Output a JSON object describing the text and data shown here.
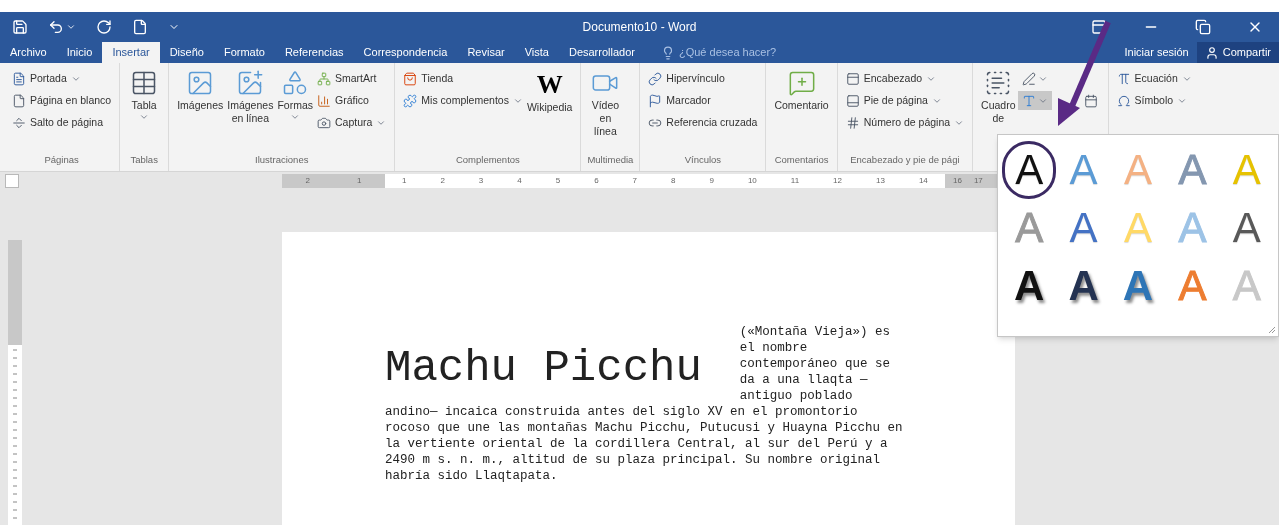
{
  "title_bar": {
    "title": "Documento10 - Word"
  },
  "tabs": [
    {
      "label": "Archivo",
      "selected": false
    },
    {
      "label": "Inicio",
      "selected": false
    },
    {
      "label": "Insertar",
      "selected": true
    },
    {
      "label": "Diseño",
      "selected": false
    },
    {
      "label": "Formato",
      "selected": false
    },
    {
      "label": "Referencias",
      "selected": false
    },
    {
      "label": "Correspondencia",
      "selected": false
    },
    {
      "label": "Revisar",
      "selected": false
    },
    {
      "label": "Vista",
      "selected": false
    },
    {
      "label": "Desarrollador",
      "selected": false
    }
  ],
  "tell_me": {
    "placeholder": "¿Qué desea hacer?"
  },
  "account": {
    "sign_in": "Iniciar sesión",
    "share": "Compartir"
  },
  "ribbon": {
    "groups": [
      {
        "label": "Páginas",
        "columns": [
          {
            "kind": "stack",
            "items": [
              {
                "label": "Portada",
                "caret": true
              },
              {
                "label": "Página en blanco",
                "caret": false
              },
              {
                "label": "Salto de página",
                "caret": false
              }
            ]
          }
        ]
      },
      {
        "label": "Tablas",
        "columns": [
          {
            "kind": "large",
            "label": "Tabla",
            "caret": true
          }
        ]
      },
      {
        "label": "Ilustraciones",
        "columns": [
          {
            "kind": "large",
            "label": "Imágenes",
            "caret": false
          },
          {
            "kind": "large",
            "label": "Imágenes en línea",
            "caret": false
          },
          {
            "kind": "large",
            "label": "Formas",
            "caret": true
          },
          {
            "kind": "stack",
            "items": [
              {
                "label": "SmartArt",
                "caret": false
              },
              {
                "label": "Gráfico",
                "caret": false
              },
              {
                "label": "Captura",
                "caret": true
              }
            ]
          }
        ]
      },
      {
        "label": "Complementos",
        "columns": [
          {
            "kind": "stack",
            "items": [
              {
                "label": "Tienda",
                "caret": false
              },
              {
                "label": "Mis complementos",
                "caret": true
              }
            ]
          },
          {
            "kind": "large",
            "label": "Wikipedia",
            "glyph": "W",
            "caret": false
          }
        ]
      },
      {
        "label": "Multimedia",
        "columns": [
          {
            "kind": "large",
            "label": "Vídeo en línea",
            "caret": false
          }
        ]
      },
      {
        "label": "Vínculos",
        "columns": [
          {
            "kind": "stack",
            "items": [
              {
                "label": "Hipervínculo",
                "caret": false
              },
              {
                "label": "Marcador",
                "caret": false
              },
              {
                "label": "Referencia cruzada",
                "caret": false
              }
            ]
          }
        ]
      },
      {
        "label": "Comentarios",
        "columns": [
          {
            "kind": "large",
            "label": "Comentario",
            "caret": false
          }
        ]
      },
      {
        "label": "Encabezado y pie de pági",
        "columns": [
          {
            "kind": "stack",
            "items": [
              {
                "label": "Encabezado",
                "caret": true
              },
              {
                "label": "Pie de página",
                "caret": true
              },
              {
                "label": "Número de página",
                "caret": true
              }
            ]
          }
        ]
      },
      {
        "columns": [
          {
            "kind": "large",
            "label": "Cuadro de",
            "caret": false
          },
          {
            "kind": "icons",
            "items": [
              {
                "caret": true,
                "pressed": false
              },
              {
                "caret": true,
                "pressed": true
              },
              {
                "caret": false,
                "pressed": false
              }
            ]
          }
        ]
      },
      {
        "columns": [
          {
            "kind": "stack",
            "items": [
              {
                "label": "Ecuación",
                "caret": true
              },
              {
                "label": "Símbolo",
                "caret": true
              }
            ]
          }
        ]
      }
    ]
  },
  "ruler": {
    "labels": [
      "2",
      "1",
      "1",
      "2",
      "3",
      "4",
      "5",
      "6",
      "7",
      "8",
      "9",
      "10",
      "11",
      "12",
      "13",
      "14",
      "16",
      "17"
    ]
  },
  "wordart_gallery": {
    "items": [
      {
        "glyph": "A",
        "kind": "fill",
        "color": "#111111",
        "circled": true
      },
      {
        "glyph": "A",
        "kind": "fill",
        "color": "#5b9bd5",
        "circled": false
      },
      {
        "glyph": "A",
        "kind": "fill",
        "color": "#f4b183",
        "circled": false
      },
      {
        "glyph": "A",
        "kind": "outline",
        "color": "#8497b0",
        "circled": false
      },
      {
        "glyph": "A",
        "kind": "fill",
        "color": "#e6c200",
        "circled": false
      },
      {
        "glyph": "A",
        "kind": "outline",
        "color": "#9a9a9a",
        "circled": false
      },
      {
        "glyph": "A",
        "kind": "fill",
        "color": "#4472c4",
        "circled": false
      },
      {
        "glyph": "A",
        "kind": "fill",
        "color": "#ffd966",
        "circled": false
      },
      {
        "glyph": "A",
        "kind": "outline",
        "color": "#9dc3e6",
        "circled": false
      },
      {
        "glyph": "A",
        "kind": "fill",
        "color": "#595959",
        "circled": false
      },
      {
        "glyph": "A",
        "kind": "shadow",
        "color": "#111111",
        "circled": false
      },
      {
        "glyph": "A",
        "kind": "shadow",
        "color": "#243352",
        "circled": false
      },
      {
        "glyph": "A",
        "kind": "shadow",
        "color": "#2e75b6",
        "circled": false
      },
      {
        "glyph": "A",
        "kind": "outline",
        "color": "#ed7d31",
        "circled": false
      },
      {
        "glyph": "A",
        "kind": "outline",
        "color": "#c8c8c8",
        "circled": false
      }
    ]
  },
  "document": {
    "heading": "Machu Picchu",
    "side_text": "(«Montaña Vieja») es el nombre contemporáneo que se da a una llaqta — antiguo poblado",
    "paragraph": "andino— incaica construida antes del siglo XV en el promontorio rocoso que une las montañas Machu Picchu, Putucusi y Huayna Picchu en la vertiente oriental de la cordillera Central, al sur del Perú y a 2490 m s. n. m., altitud de su plaza principal. Su nombre original habría sido Llaqtapata."
  }
}
